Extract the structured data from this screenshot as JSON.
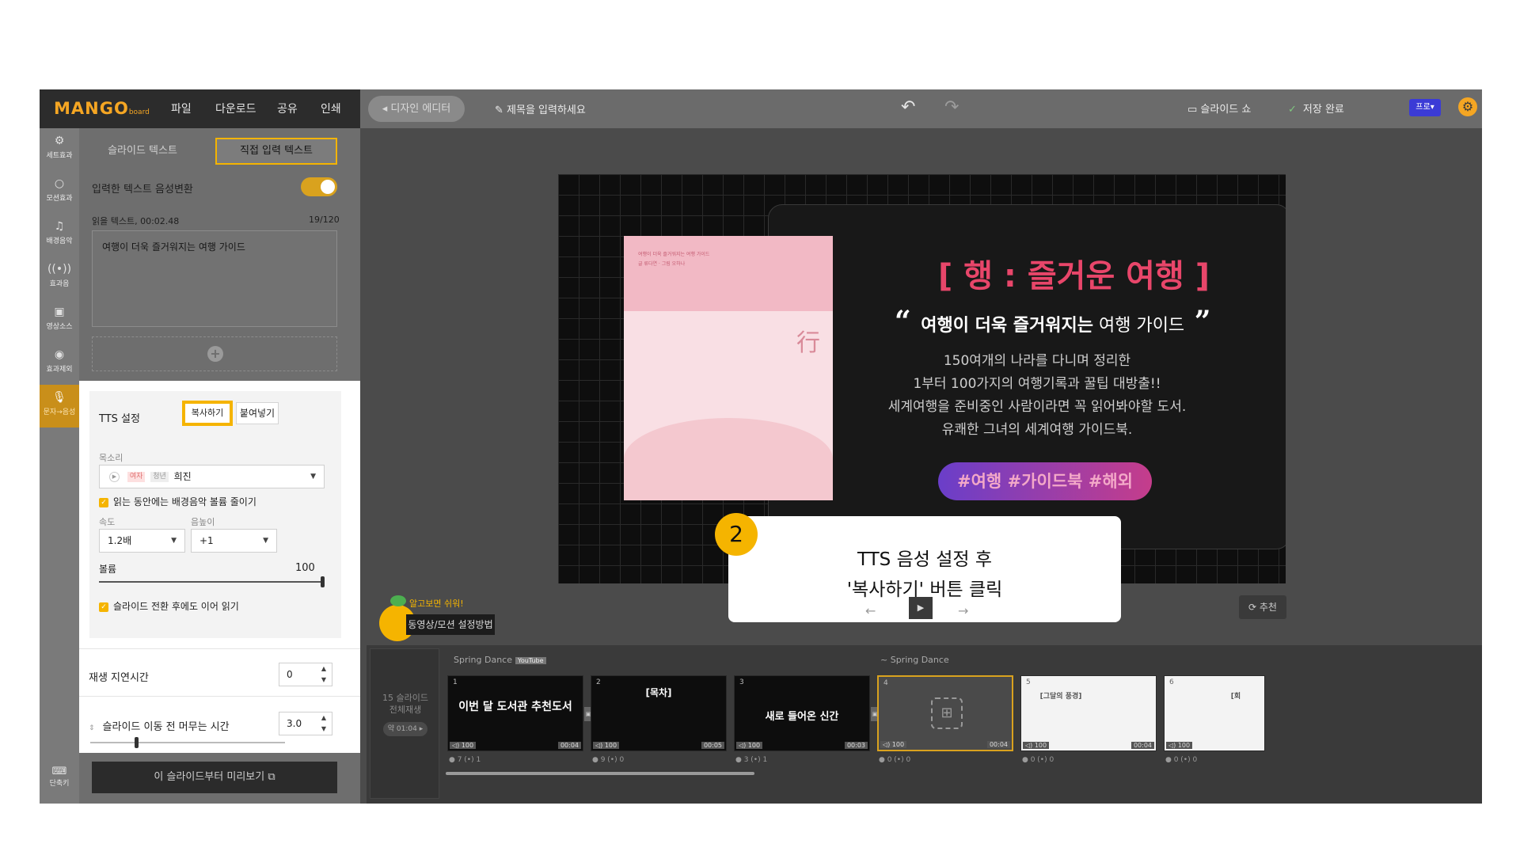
{
  "app": {
    "logo": "MANGO",
    "logo_sub": "board",
    "menu": [
      "파일",
      "다운로드",
      "공유",
      "인쇄"
    ],
    "design_editor": "◂ 디자인 에디터",
    "title_placeholder": "제목을 입력하세요",
    "slideshow": "슬라이드 쇼",
    "save_status": "저장 완료",
    "pro_badge": "프로"
  },
  "toolbar": {
    "items": [
      {
        "label": "세트효과",
        "icon": "gear-icon"
      },
      {
        "label": "모션효과",
        "icon": "circle-icon"
      },
      {
        "label": "배경음악",
        "icon": "music-note-icon"
      },
      {
        "label": "효과음",
        "icon": "sound-wave-icon"
      },
      {
        "label": "영상소스",
        "icon": "video-icon"
      },
      {
        "label": "효과제외",
        "icon": "exclude-icon"
      },
      {
        "label": "문자→음성",
        "icon": "microphone-icon"
      }
    ],
    "shortcut": "단축키"
  },
  "panel": {
    "tab_slide_text": "슬라이드 텍스트",
    "tab_direct_text": "직접 입력 텍스트",
    "tts_toggle_label": "입력한 텍스트 음성변환",
    "read_label": "읽을 텍스트, 00:02.48",
    "read_count": "19/120",
    "read_text": "여행이 더욱 즐거워지는 여행 가이드",
    "tts_settings": "TTS 설정",
    "copy": "복사하기",
    "paste": "붙여넣기",
    "voice_label": "목소리",
    "voice_tag_female": "여자",
    "voice_tag_young": "청년",
    "voice_name": "희진",
    "lower_bgm": "읽는 동안에는 배경음악 볼륨 줄이기",
    "speed_label": "속도",
    "speed_value": "1.2배",
    "pitch_label": "음높이",
    "pitch_value": "+1",
    "volume_label": "볼륨",
    "volume_value": "100",
    "continue_reading": "슬라이드 전환 후에도 이어 읽기",
    "play_delay_label": "재생 지연시간",
    "play_delay_value": "0",
    "stay_time_label": "슬라이드 이동 전 머무는 시간",
    "stay_time_value": "3.0",
    "preview": "이 슬라이드부터 미리보기"
  },
  "slide": {
    "heading": "[ 행 : 즐거운 여행 ]",
    "quote_bold": "여행이 더욱 즐거워지는",
    "quote_rest": " 여행 가이드",
    "desc": [
      "150여개의 나라를 다니며 정리한",
      "1부터 100가지의 여행기록과 꿀팁 대방출!!",
      "세계여행을 준비중인 사람이라면 꼭 읽어봐야할 도서.",
      "유쾌한 그녀의 세계여행 가이드북."
    ],
    "hashtags": "#여행 #가이드북 #해외",
    "book_line1": "여행이 더욱 즐거워지는 여행 가이드",
    "book_line2": "글 류다연 · 그림 오하나",
    "book_glyph": "行"
  },
  "callout": {
    "step": "2",
    "line1": "TTS 음성 설정 후",
    "line2": "'복사하기' 버튼 클릭"
  },
  "canvas": {
    "recommend": "추천",
    "tip_title": "알고보면 쉬워!",
    "tip_button": "동영상/모션 설정방법"
  },
  "timeline": {
    "left_line1": "15 슬라이드",
    "left_line2": "전체재생",
    "left_duration": "약 01:04 ▸",
    "music_left": "Spring Dance",
    "music_badge": "YouTube",
    "music_right": "~ Spring Dance",
    "slides": [
      {
        "num": "1",
        "title": "이번 달 도서관 추천도서",
        "vol": "100",
        "dur": "00:04",
        "stats": "● 7   (•) 1"
      },
      {
        "num": "2",
        "title": "[목차]",
        "vol": "100",
        "dur": "00:05",
        "stats": "● 9   (•) 0"
      },
      {
        "num": "3",
        "title": "새로 들어온 신간",
        "vol": "100",
        "dur": "00:03",
        "stats": "● 3   (•) 1"
      },
      {
        "num": "4",
        "title": "",
        "vol": "100",
        "dur": "00:04",
        "stats": "● 0   (•) 0"
      },
      {
        "num": "5",
        "title": "[그달의 풍경]",
        "vol": "100",
        "dur": "00:04",
        "stats": "● 0   (•) 0"
      },
      {
        "num": "6",
        "title": "[회",
        "vol": "100",
        "dur": "",
        "stats": "● 0   (•) 0"
      }
    ]
  }
}
